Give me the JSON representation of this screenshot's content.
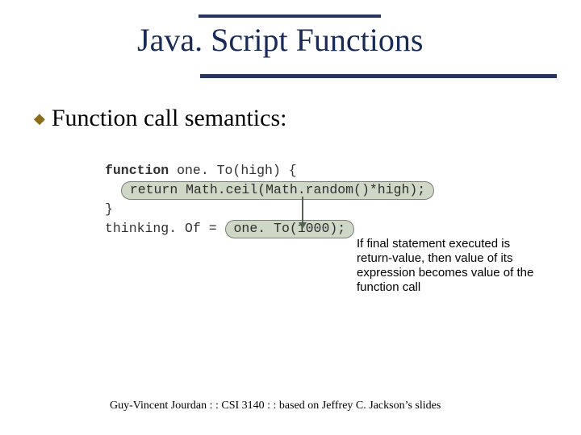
{
  "title": "Java. Script Functions",
  "bullet": "Function call semantics:",
  "code": {
    "line1a": "function",
    "line1b": " one. To(high) {",
    "line2_pill": "return Math.ceil(Math.random()*high);",
    "line3": "}",
    "line4a": "thinking. Of = ",
    "line4_pill": "one. To(1000);"
  },
  "note": "If final statement executed is return-value, then value of its expression becomes value of the function call",
  "footer": "Guy-Vincent Jourdan : : CSI 3140 : : based on Jeffrey C. Jackson’s slides"
}
